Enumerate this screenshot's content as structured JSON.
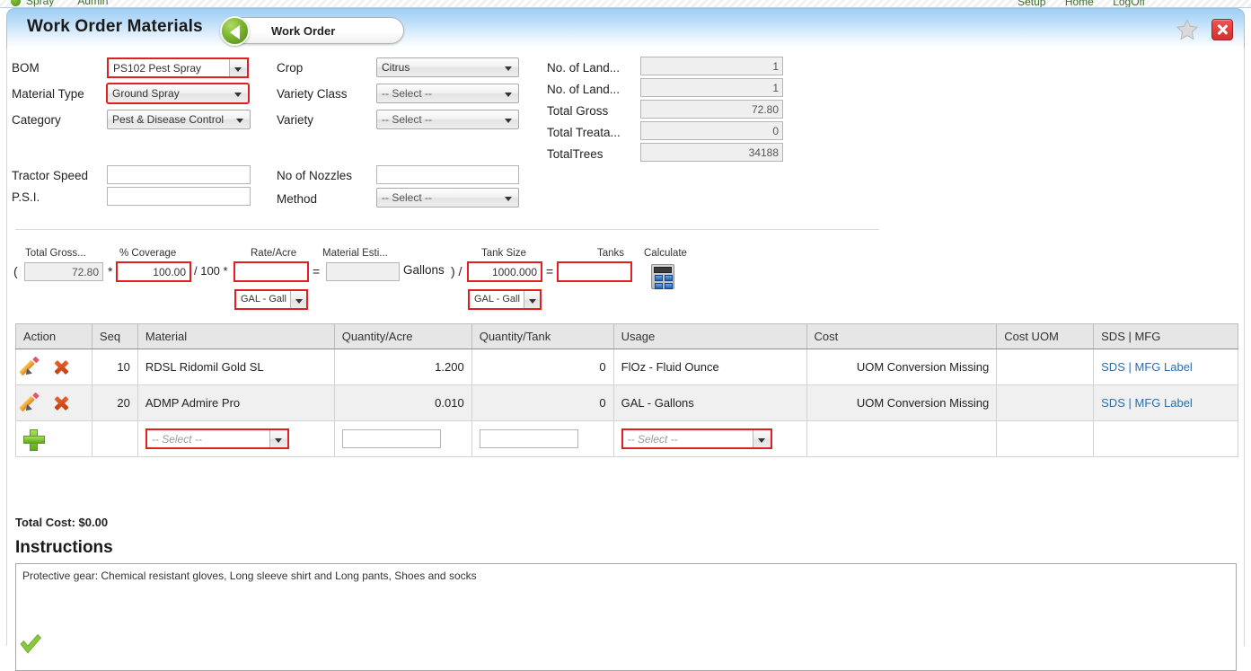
{
  "topnav": {
    "left_links": [
      "Spray",
      "Admin"
    ],
    "right_links": [
      "Setup",
      "Home",
      "LogOff"
    ]
  },
  "header": {
    "title": "Work Order Materials",
    "back_button_label": "Work Order",
    "favorite_icon": "star-icon",
    "close_icon": "close-icon"
  },
  "form": {
    "col1": [
      {
        "label": "BOM",
        "value": "PS102 Pest Spray",
        "style": "combo",
        "highlight": true
      },
      {
        "label": "Material Type",
        "value": "Ground Spray",
        "style": "select",
        "highlight": true
      },
      {
        "label": "Category",
        "value": "Pest & Disease Control",
        "style": "select",
        "highlight": false
      }
    ],
    "col2": [
      {
        "label": "Crop",
        "value": "Citrus",
        "placeholder": false
      },
      {
        "label": "Variety Class",
        "value": "-- Select --",
        "placeholder": true
      },
      {
        "label": "Variety",
        "value": "-- Select --",
        "placeholder": true
      }
    ],
    "col3": [
      {
        "label": "No. of Land...",
        "value": "1"
      },
      {
        "label": "No. of Land...",
        "value": "1"
      },
      {
        "label": "Total Gross",
        "value": "72.80"
      },
      {
        "label": "Total Treata...",
        "value": "0"
      },
      {
        "label": "TotalTrees",
        "value": "34188"
      }
    ],
    "row2_left": [
      {
        "label": "Tractor Speed",
        "value": ""
      },
      {
        "label": "P.S.I.",
        "value": ""
      }
    ],
    "row2_right": [
      {
        "label": "No of Nozzles",
        "value": "",
        "type": "text"
      },
      {
        "label": "Method",
        "value": "-- Select --",
        "type": "select",
        "placeholder": true
      }
    ]
  },
  "calc": {
    "headers": {
      "total_gross": "Total Gross...",
      "coverage": "% Coverage",
      "rate_acre": "Rate/Acre",
      "material_est": "Material Esti...",
      "tank_size": "Tank Size",
      "tanks": "Tanks",
      "calculate": "Calculate"
    },
    "open_paren": "(",
    "times1": "*",
    "div100": "/ 100 *",
    "equals1": "=",
    "gallons_label": "Gallons",
    "close_paren_div": ") /",
    "equals2": "=",
    "values": {
      "total_gross": "72.80",
      "coverage": "100.00",
      "rate_acre": "",
      "rate_uom": "GAL - Gall",
      "material_est": "",
      "tank_size": "1000.000",
      "tank_uom": "GAL - Gall",
      "tanks": ""
    },
    "calculator_icon": "calculator-icon"
  },
  "grid": {
    "columns": [
      "Action",
      "Seq",
      "Material",
      "Quantity/Acre",
      "Quantity/Tank",
      "Usage",
      "Cost",
      "Cost UOM",
      "SDS | MFG"
    ],
    "rows": [
      {
        "seq": "10",
        "material": "RDSL Ridomil Gold SL",
        "qty_acre": "1.200",
        "qty_tank": "0",
        "usage": "FlOz - Fluid Ounce",
        "cost": "UOM Conversion Missing",
        "cost_uom": "",
        "sds": "SDS",
        "sep": "|",
        "mfg": "MFG Label"
      },
      {
        "seq": "20",
        "material": "ADMP Admire Pro",
        "qty_acre": "0.010",
        "qty_tank": "0",
        "usage": "GAL - Gallons",
        "cost": "UOM Conversion Missing",
        "cost_uom": "",
        "sds": "SDS",
        "sep": "|",
        "mfg": "MFG Label"
      }
    ],
    "new_row": {
      "material_placeholder": "-- Select --",
      "qty_acre": "",
      "qty_tank": "",
      "usage_placeholder": "-- Select --"
    }
  },
  "footer": {
    "total_cost": "Total Cost: $0.00",
    "instructions_heading": "Instructions",
    "instructions_text": "Protective gear: Chemical resistant gloves, Long sleeve shirt and Long pants, Shoes and socks",
    "submit_icon": "green-check-icon"
  },
  "colors": {
    "header_blue": "#9fcdf4",
    "warning_red": "#e02222",
    "link_blue": "#2d6ea8",
    "highlight_red": "#e02020",
    "green": "#7cb62e"
  }
}
